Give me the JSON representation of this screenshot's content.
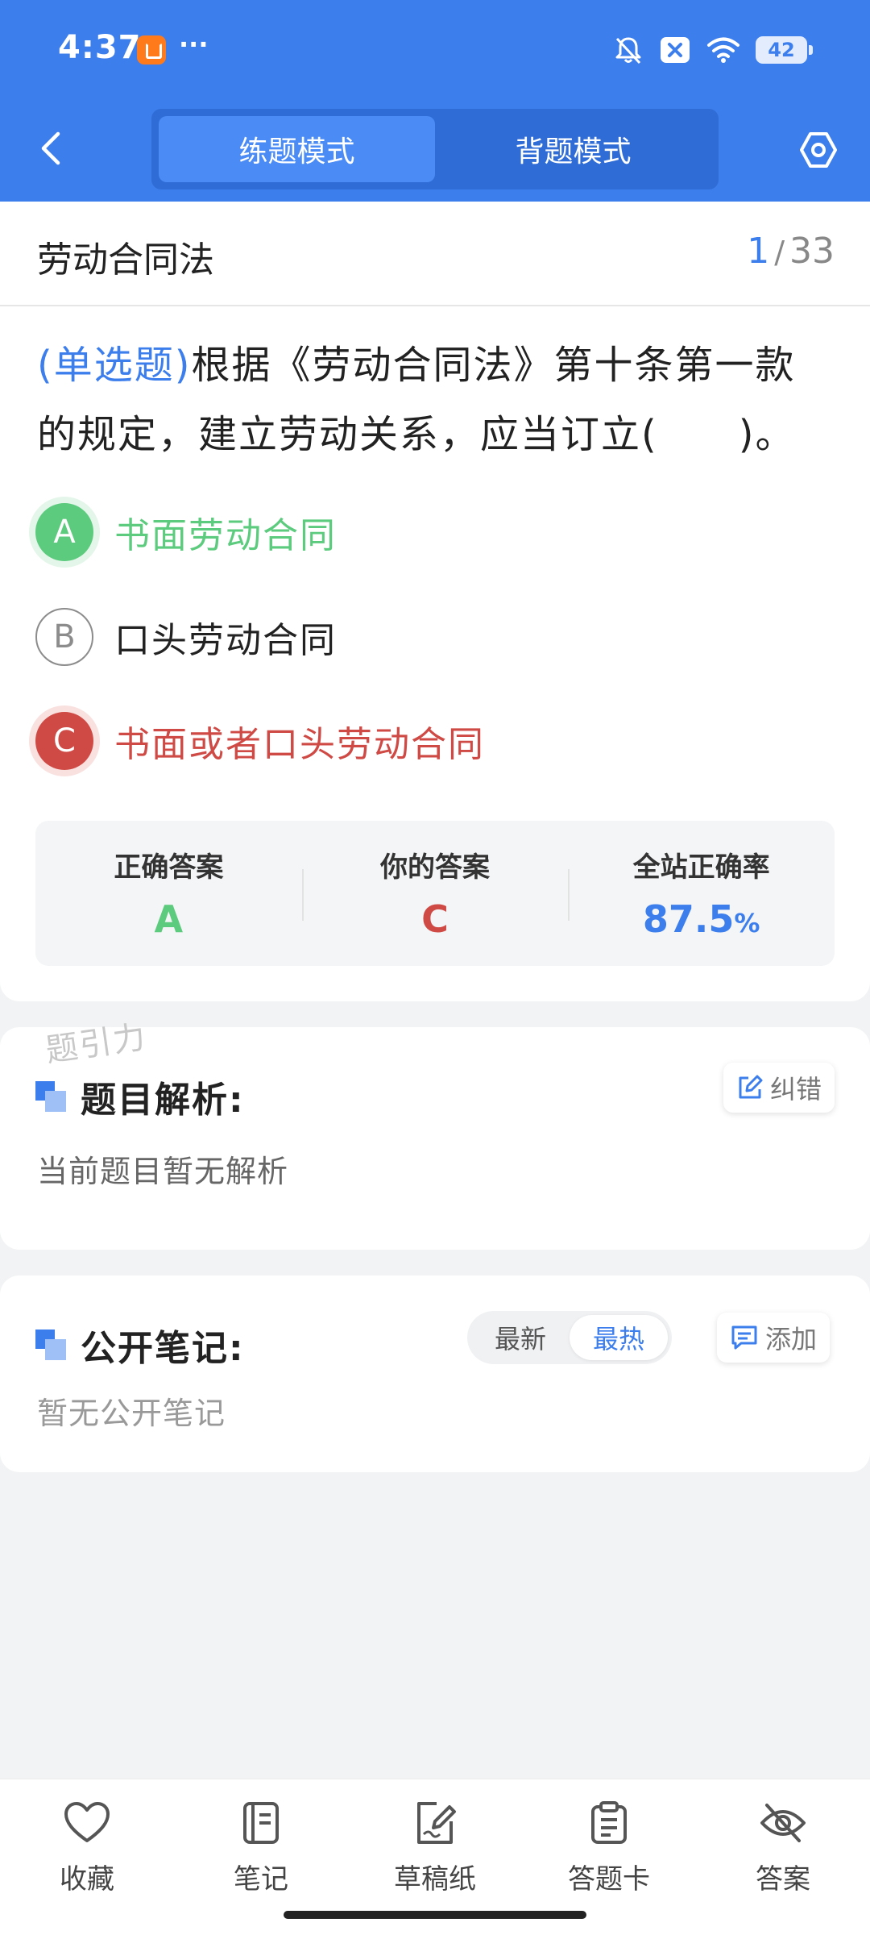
{
  "status_bar": {
    "time": "4:37",
    "more": "···",
    "battery": "42"
  },
  "header": {
    "tabs": [
      {
        "label": "练题模式",
        "active": true
      },
      {
        "label": "背题模式",
        "active": false
      }
    ]
  },
  "question_header": {
    "chapter": "劳动合同法",
    "current": "1",
    "total": "33"
  },
  "question": {
    "type": "(单选题)",
    "text": "根据《劳动合同法》第十条第一款的规定，建立劳动关系，应当订立(　　)。",
    "options": [
      {
        "letter": "A",
        "text": "书面劳动合同",
        "state": "correct"
      },
      {
        "letter": "B",
        "text": "口头劳动合同",
        "state": "normal"
      },
      {
        "letter": "C",
        "text": "书面或者口头劳动合同",
        "state": "wrong"
      }
    ]
  },
  "stats": {
    "correct_label": "正确答案",
    "correct_value": "A",
    "yours_label": "你的答案",
    "yours_value": "C",
    "rate_label": "全站正确率",
    "rate_value": "87.5",
    "rate_unit": "%"
  },
  "analysis": {
    "watermark": "题引力",
    "title": "题目解析:",
    "report_label": "纠错",
    "empty_text": "当前题目暂无解析"
  },
  "notes": {
    "title": "公开笔记:",
    "sort_options": [
      "最新",
      "最热"
    ],
    "sort_active": "最热",
    "add_label": "添加",
    "empty_text": "暂无公开笔记"
  },
  "bottom_nav": [
    {
      "label": "收藏",
      "icon": "heart-icon"
    },
    {
      "label": "笔记",
      "icon": "notebook-icon"
    },
    {
      "label": "草稿纸",
      "icon": "draft-paper-icon"
    },
    {
      "label": "答题卡",
      "icon": "answer-card-icon"
    },
    {
      "label": "答案",
      "icon": "eye-off-icon"
    }
  ],
  "colors": {
    "primary": "#3d7eed",
    "correct": "#5ccb7e",
    "wrong": "#cf4a45",
    "background": "#f2f3f5"
  }
}
